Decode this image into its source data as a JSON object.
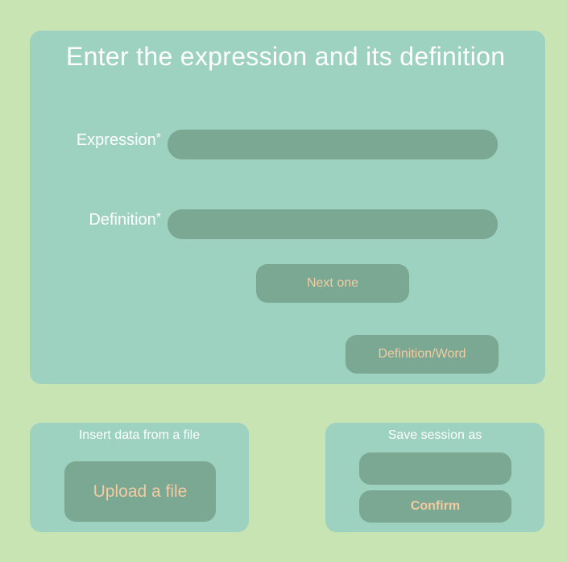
{
  "main": {
    "title": "Enter the expression and its definition",
    "expression_label": "Expression",
    "definition_label": "Definition",
    "required_marker": "*",
    "expression_value": "",
    "definition_value": "",
    "next_label": "Next one",
    "toggle_label": "Definition/Word"
  },
  "file_panel": {
    "caption": "Insert data from a file",
    "upload_label": "Upload a file"
  },
  "save_panel": {
    "caption": "Save session as",
    "session_value": "",
    "confirm_label": "Confirm"
  },
  "colors": {
    "background": "#c9e4b3",
    "panel": "#9dd2c0",
    "control": "#7aa893",
    "button_text": "#f3cba1",
    "label_text": "#ffffff"
  }
}
